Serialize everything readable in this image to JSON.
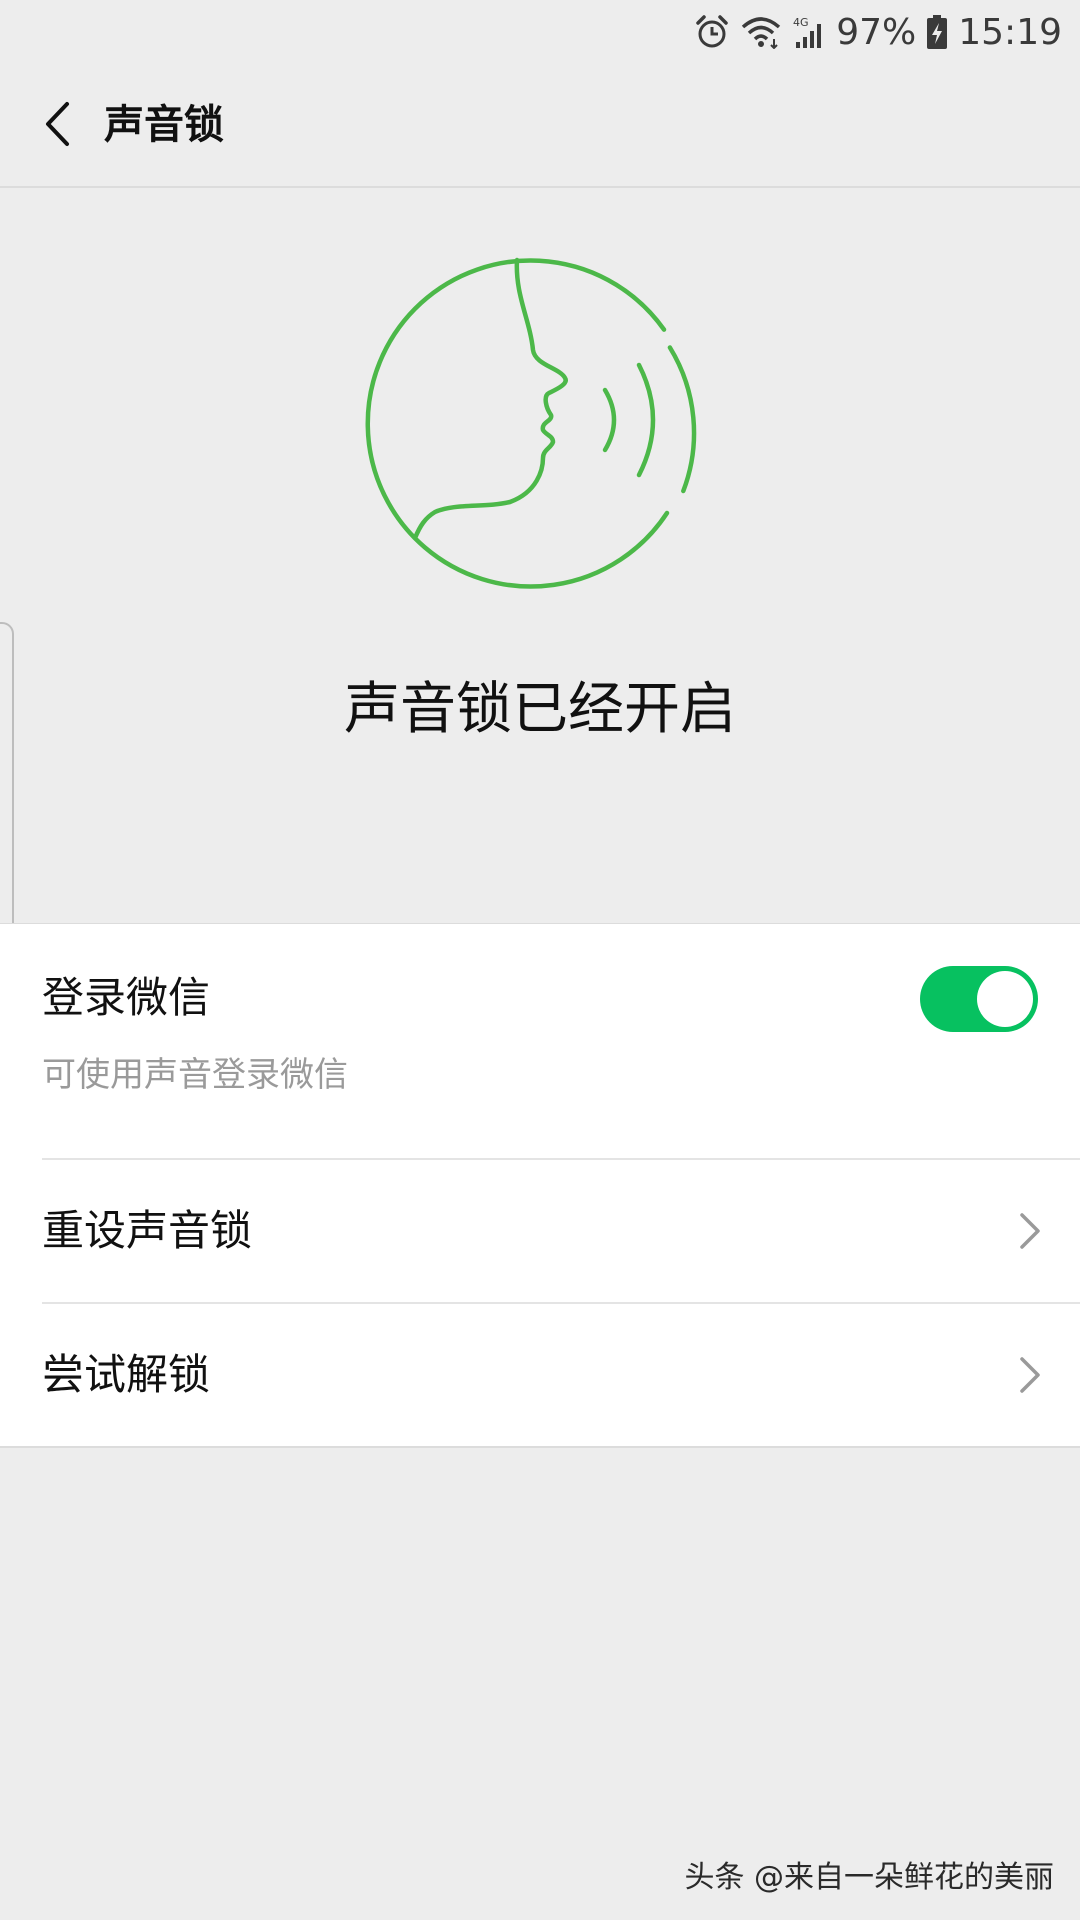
{
  "status_bar": {
    "battery": "97%",
    "time": "15:19",
    "network": "4G",
    "icons": [
      "alarm-icon",
      "wifi-icon",
      "cell-signal-icon",
      "battery-charging-icon"
    ]
  },
  "nav": {
    "title": "声音锁",
    "back_icon": "chevron-left-icon"
  },
  "hero": {
    "illustration_icon": "voice-face-icon",
    "status_text": "声音锁已经开启"
  },
  "settings": {
    "login": {
      "title": "登录微信",
      "description": "可使用声音登录微信",
      "enabled": true
    },
    "items": [
      {
        "label": "重设声音锁",
        "icon": "chevron-right-icon"
      },
      {
        "label": "尝试解锁",
        "icon": "chevron-right-icon"
      }
    ]
  },
  "watermark": "头条 @来自一朵鲜花的美丽",
  "colors": {
    "accent_green": "#07c160",
    "illustration_green": "#4cb849",
    "background": "#ededed",
    "card": "#ffffff",
    "secondary_text": "#9a9a9a"
  }
}
